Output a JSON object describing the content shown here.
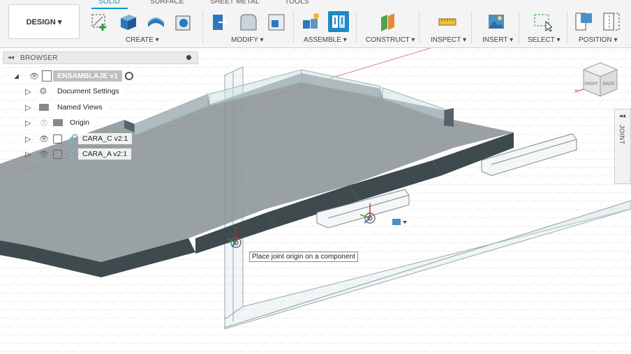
{
  "workspace": {
    "label": "DESIGN ▾"
  },
  "tabs": [
    "SOLID",
    "SURFACE",
    "SHEET METAL",
    "TOOLS"
  ],
  "groups": {
    "create": "CREATE ▾",
    "modify": "MODIFY ▾",
    "assemble": "ASSEMBLE ▾",
    "construct": "CONSTRUCT ▾",
    "inspect": "INSPECT ▾",
    "insert": "INSERT ▾",
    "select": "SELECT ▾",
    "position": "POSITION ▾"
  },
  "browser": {
    "title": "BROWSER",
    "items": [
      {
        "label": "ENSAMBLAJE v1"
      },
      {
        "label": "Document Settings"
      },
      {
        "label": "Named Views"
      },
      {
        "label": "Origin"
      },
      {
        "label": "CARA_C v2:1"
      },
      {
        "label": "CARA_A v2:1"
      }
    ]
  },
  "tooltip": "Place joint origin on a component",
  "joint_panel": "JOINT",
  "viewcube": {
    "right": "RIGHT",
    "back": "BACK",
    "x_axis": "X"
  },
  "colors": {
    "accent": "#0696d7",
    "plate_top": "#8f979a",
    "plate_side": "#3e4a4d"
  }
}
